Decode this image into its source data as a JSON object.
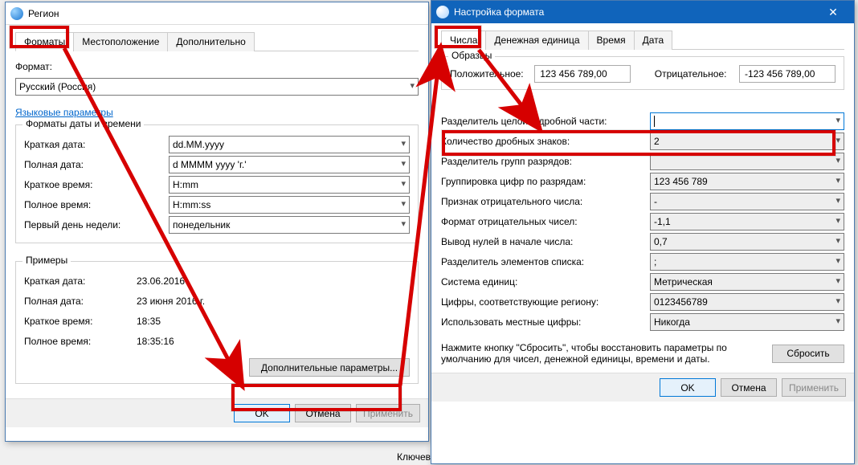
{
  "win1": {
    "title": "Регион",
    "tabs": [
      "Форматы",
      "Местоположение",
      "Дополнительно"
    ],
    "format_label": "Формат:",
    "format_value": "Русский (Россия)",
    "lang_link": "Языковые параметры",
    "dt_group": "Форматы даты и времени",
    "rows": [
      {
        "lbl": "Краткая дата:",
        "val": "dd.MM.yyyy"
      },
      {
        "lbl": "Полная дата:",
        "val": "d MMMM yyyy 'г.'"
      },
      {
        "lbl": "Краткое время:",
        "val": "H:mm"
      },
      {
        "lbl": "Полное время:",
        "val": "H:mm:ss"
      },
      {
        "lbl": "Первый день недели:",
        "val": "понедельник"
      }
    ],
    "examples_group": "Примеры",
    "examples": [
      {
        "lbl": "Краткая дата:",
        "val": "23.06.2016"
      },
      {
        "lbl": "Полная дата:",
        "val": "23 июня 2016 г."
      },
      {
        "lbl": "Краткое время:",
        "val": "18:35"
      },
      {
        "lbl": "Полное время:",
        "val": "18:35:16"
      }
    ],
    "extra_btn": "Дополнительные параметры...",
    "ok": "OK",
    "cancel": "Отмена",
    "apply": "Применить",
    "cut_label": "Ключевы"
  },
  "win2": {
    "title": "Настройка формата",
    "close": "✕",
    "tabs": [
      "Числа",
      "Денежная единица",
      "Время",
      "Дата"
    ],
    "sample_group": "Образцы",
    "pos_lbl": "Положительное:",
    "pos_val": "123 456 789,00",
    "neg_lbl": "Отрицательное:",
    "neg_val": "-123 456 789,00",
    "rows": [
      {
        "lbl": "Разделитель целой и дробной части:",
        "val": ""
      },
      {
        "lbl": "Количество дробных знаков:",
        "val": "2"
      },
      {
        "lbl": "Разделитель групп разрядов:",
        "val": ""
      },
      {
        "lbl": "Группировка цифр по разрядам:",
        "val": "123 456 789"
      },
      {
        "lbl": "Признак отрицательного числа:",
        "val": "-"
      },
      {
        "lbl": "Формат отрицательных чисел:",
        "val": "-1,1"
      },
      {
        "lbl": "Вывод нулей в начале числа:",
        "val": "0,7"
      },
      {
        "lbl": "Разделитель элементов списка:",
        "val": ";"
      },
      {
        "lbl": "Система единиц:",
        "val": "Метрическая"
      },
      {
        "lbl": "Цифры, соответствующие региону:",
        "val": "0123456789"
      },
      {
        "lbl": "Использовать местные цифры:",
        "val": "Никогда"
      }
    ],
    "reset_hint": "Нажмите кнопку \"Сбросить\", чтобы восстановить параметры по умолчанию для чисел, денежной единицы, времени и даты.",
    "reset": "Сбросить",
    "ok": "OK",
    "cancel": "Отмена",
    "apply": "Применить"
  }
}
